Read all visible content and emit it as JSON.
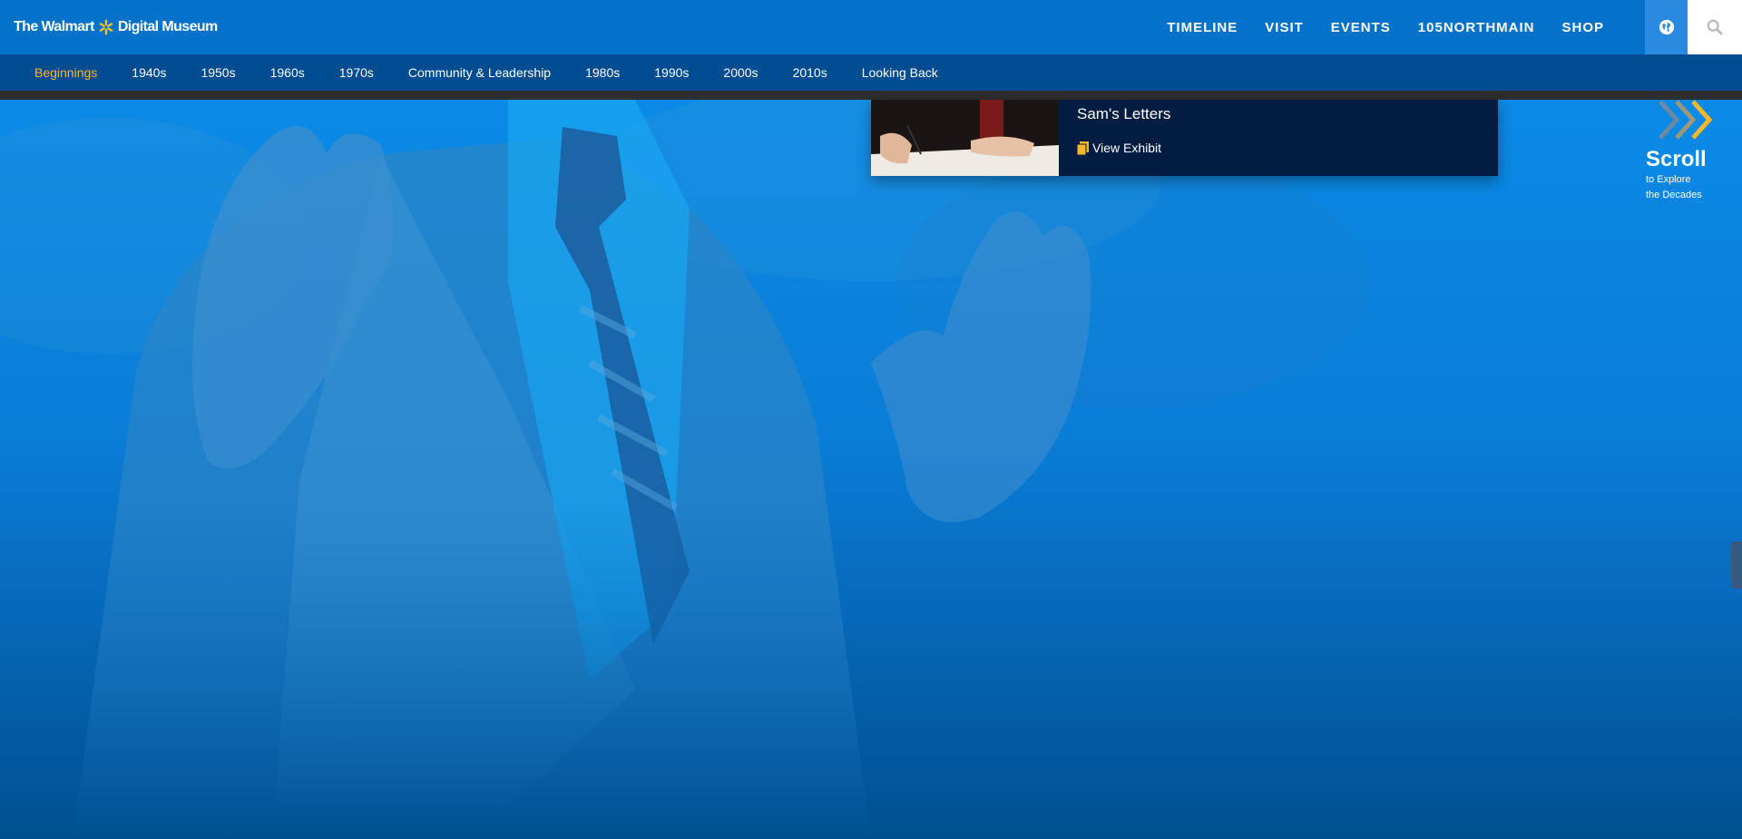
{
  "header": {
    "logo_prefix": "The Walmart",
    "logo_suffix": "Digital Museum",
    "nav": [
      "TIMELINE",
      "VISIT",
      "EVENTS",
      "105NORTHMAIN",
      "SHOP"
    ]
  },
  "decades": {
    "items": [
      "Beginnings",
      "1940s",
      "1950s",
      "1960s",
      "1970s",
      "Community & Leadership",
      "1980s",
      "1990s",
      "2000s",
      "2010s",
      "Looking Back"
    ],
    "active": "Beginnings"
  },
  "exhibit": {
    "title": "Sam's Letters",
    "link_label": "View Exhibit",
    "link_icon": "document-icon"
  },
  "scroll_cue": {
    "title": "Scroll",
    "line1": "to Explore",
    "line2": "the Decades",
    "icon": "chevrons-right-icon"
  },
  "colors": {
    "header_bg": "#0472c9",
    "decade_nav_bg": "#004c91",
    "active_accent": "#f5b82c",
    "card_bg": "#021c42",
    "spark_yellow": "#ffc220"
  }
}
